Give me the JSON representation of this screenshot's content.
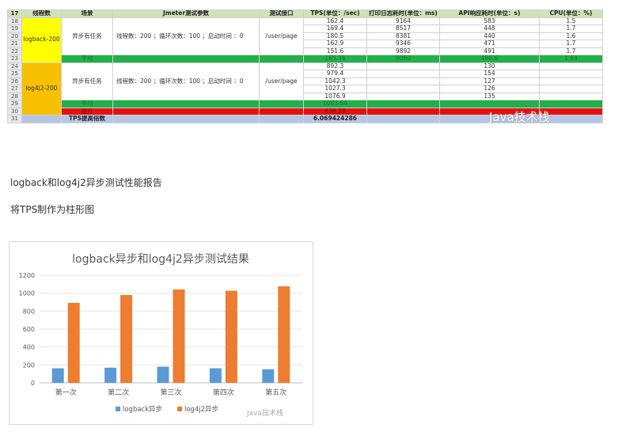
{
  "sheet": {
    "headers": [
      "线程数",
      "场景",
      "Jmeter测试参数",
      "测试接口",
      "TPS(单位：/sec)",
      "打印日志耗时(单位：ms)",
      "API响应耗时(单位：s)",
      "CPU(单位：%)"
    ],
    "row_numbers": [
      "17",
      "18",
      "19",
      "20",
      "21",
      "22",
      "23",
      "24",
      "25",
      "26",
      "27",
      "28",
      "29",
      "30",
      "31"
    ],
    "logback": {
      "label": "logback-200",
      "scene": "异步有任务",
      "params": "线程数：200 ；循环次数：100 ；启动时间 ：0",
      "api": "/user/page",
      "rows": [
        {
          "tps": "162.4",
          "log": "9164",
          "resp": "583",
          "cpu": "1.5"
        },
        {
          "tps": "169.4",
          "log": "8517",
          "resp": "448",
          "cpu": "1.7"
        },
        {
          "tps": "180.5",
          "log": "8381",
          "resp": "440",
          "cpu": "1.6"
        },
        {
          "tps": "162.9",
          "log": "9346",
          "resp": "471",
          "cpu": "1.7"
        },
        {
          "tps": "151.6",
          "log": "9892",
          "resp": "491",
          "cpu": "1.7"
        }
      ],
      "avg": {
        "label": "平均",
        "tps": "165.36",
        "log": "9060",
        "resp": "486.6",
        "cpu": "1.64"
      }
    },
    "log4j2": {
      "label": "log4j2-200",
      "scene": "异步有任务",
      "params": "线程数：200 ；循环次数：100 ；启动时间 ：0",
      "api": "/user/page",
      "rows": [
        {
          "tps": "892.3",
          "resp": "130"
        },
        {
          "tps": "979.4",
          "resp": "154"
        },
        {
          "tps": "1042.3",
          "resp": "127"
        },
        {
          "tps": "1027.3",
          "resp": "126"
        },
        {
          "tps": "1076.9",
          "resp": "135"
        }
      ],
      "avg": {
        "label": "平均",
        "tps": "1003.64"
      },
      "improve": {
        "label": "提升",
        "tps": "838.28"
      }
    },
    "tps_ratio": {
      "label": "TPS提高倍数",
      "value": "6.069424286"
    }
  },
  "watermark": "Java技术栈",
  "text": {
    "line1": "logback和log4j2异步测试性能报告",
    "line2": "将TPS制作为柱形图"
  },
  "chart_data": {
    "type": "bar",
    "title": "logback异步和log4j2异步测试结果",
    "categories": [
      "第一次",
      "第二次",
      "第三次",
      "第四次",
      "第五次"
    ],
    "series": [
      {
        "name": "logback异步",
        "values": [
          162.4,
          169.4,
          180.5,
          162.9,
          151.6
        ],
        "color": "#5b9bd5"
      },
      {
        "name": "log4j2异步",
        "values": [
          892.3,
          979.4,
          1042.3,
          1027.3,
          1076.9
        ],
        "color": "#ed7d31"
      }
    ],
    "ylim": [
      0,
      1200
    ],
    "yticks": [
      "0",
      "200",
      "400",
      "600",
      "800",
      "1000",
      "1200"
    ],
    "legend": "bottom",
    "grid": true
  }
}
